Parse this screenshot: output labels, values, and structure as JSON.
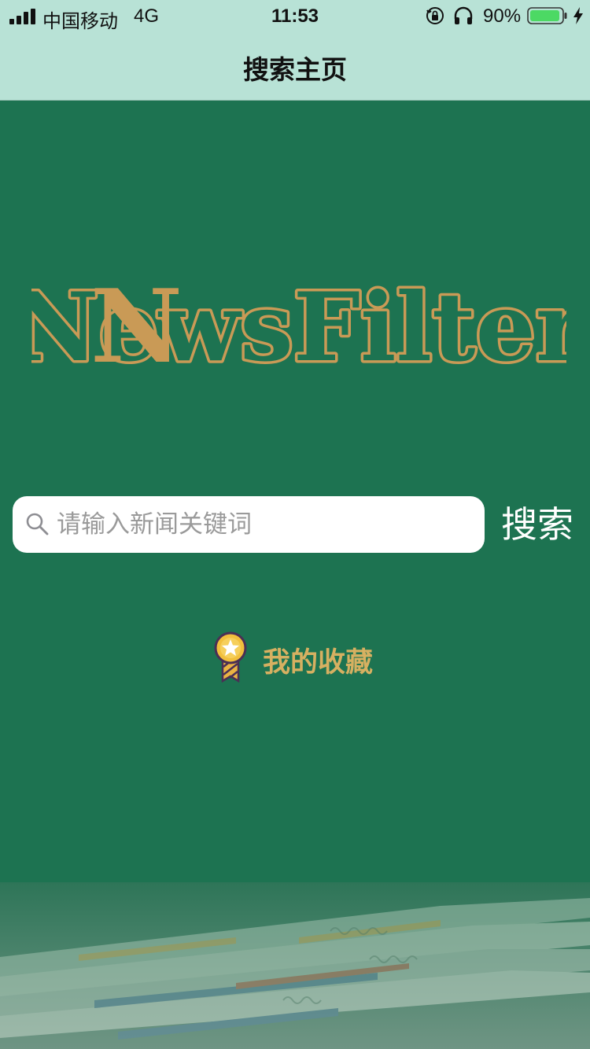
{
  "status_bar": {
    "carrier": "中国移动",
    "network": "4G",
    "time": "11:53",
    "battery_percent": "90%",
    "icons": [
      "signal-icon",
      "rotation-lock-icon",
      "headphone-icon",
      "battery-icon",
      "charging-icon"
    ]
  },
  "nav": {
    "title": "搜索主页"
  },
  "logo": {
    "text": "NewsFilter"
  },
  "search": {
    "placeholder": "请输入新闻关键词",
    "value": "",
    "button_label": "搜索",
    "icon": "search-icon"
  },
  "favorites": {
    "label": "我的收藏",
    "icon": "medal-icon"
  },
  "colors": {
    "background": "#1d7351",
    "topbar": "#b8e2d6",
    "logo": "#c99a56",
    "favorites_text": "#d6b061",
    "battery": "#4cd964"
  }
}
